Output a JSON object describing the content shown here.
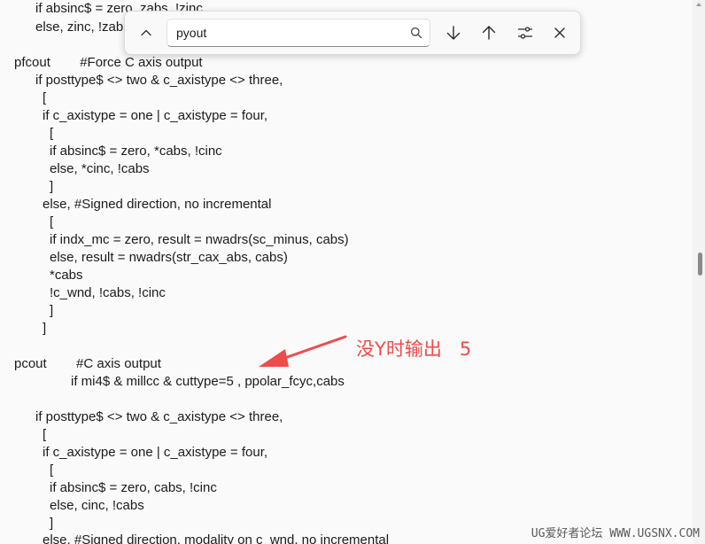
{
  "find_bar": {
    "query": "pyout",
    "placeholder": "",
    "collapse_icon": "chevron-up-icon",
    "search_icon": "search-icon",
    "next_icon": "arrow-down-icon",
    "prev_icon": "arrow-up-icon",
    "options_icon": "sliders-icon",
    "close_icon": "close-icon"
  },
  "code_lines": [
    "if absinc$ = zero, zabs, !zinc",
    "else, zinc, !zab",
    "pfcout        #Force C axis output",
    "if posttype$ <> two & c_axistype <> three,",
    "[",
    "if c_axistype = one | c_axistype = four,",
    "[",
    "if absinc$ = zero, *cabs, !cinc",
    "else, *cinc, !cabs",
    "]",
    "else, #Signed direction, no incremental",
    "[",
    "if indx_mc = zero, result = nwadrs(sc_minus, cabs)",
    "else, result = nwadrs(str_cax_abs, cabs)",
    "*cabs",
    "!c_wnd, !cabs, !cinc",
    "]",
    "]",
    "pcout        #C axis output",
    "if mi4$ & millcc & cuttype=5 , ppolar_fcyc,cabs",
    "if posttype$ <> two & c_axistype <> three,",
    "[",
    "if c_axistype = one | c_axistype = four,",
    "[",
    "if absinc$ = zero, cabs, !cinc",
    "else, cinc, !cabs",
    "]",
    "else, #Signed direction, modality on c_wnd, no incremental"
  ],
  "annotation": {
    "text": "没Y时输出   5",
    "color": "#ef4b4b"
  },
  "watermark": "UG爱好者论坛 WWW.UGSNX.COM"
}
